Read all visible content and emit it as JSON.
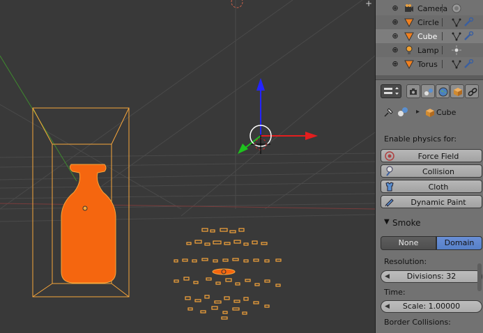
{
  "outliner": {
    "items": [
      {
        "name": "Camera",
        "icon": "camera-icon",
        "selected": false
      },
      {
        "name": "Circle",
        "icon": "mesh-icon",
        "selected": false
      },
      {
        "name": "Cube",
        "icon": "mesh-icon",
        "selected": true
      },
      {
        "name": "Lamp",
        "icon": "lamp-icon",
        "selected": false
      },
      {
        "name": "Torus",
        "icon": "mesh-icon",
        "selected": false
      }
    ]
  },
  "viewport": {
    "plus_label": "+"
  },
  "properties": {
    "breadcrumb_object": "Cube",
    "enable_physics_label": "Enable physics for:",
    "physics_buttons": [
      "Force Field",
      "Collision",
      "Cloth",
      "Dynamic Paint"
    ],
    "smoke_panel_title": "Smoke",
    "smoke_type_options": [
      "None",
      "Domain"
    ],
    "smoke_type_selected": "Domain",
    "resolution_label": "Resolution:",
    "divisions_field": "Divisions: 32",
    "time_label": "Time:",
    "scale_field": "Scale: 1.00000",
    "border_collisions_label": "Border Collisions:"
  },
  "colors": {
    "viewport_bg": "#393939",
    "selection_orange": "#f5660f",
    "outline_orange": "#f8a63a",
    "panel_bg": "#727272",
    "active_blue": "#5680c8"
  }
}
